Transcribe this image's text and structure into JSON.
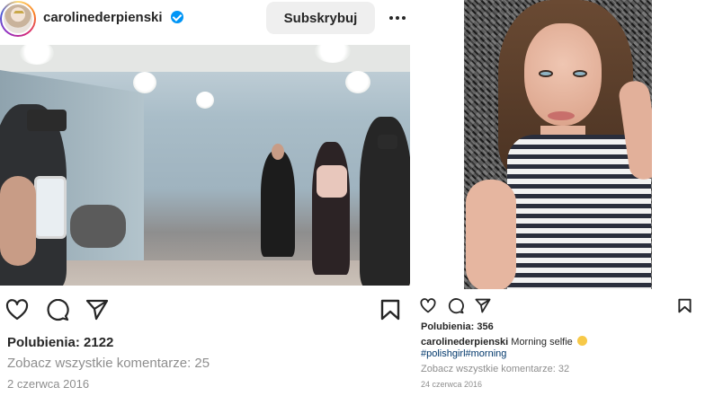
{
  "left_post": {
    "username": "carolinederpienski",
    "verified_icon": "verified-badge-icon",
    "follow_label": "Subskrybuj",
    "more_icon": "more-options-icon",
    "likes": "Polubienia: 2122",
    "comments_link": "Zobacz wszystkie komentarze: 25",
    "date": "2 czerwca 2016",
    "actions": [
      "heart-icon",
      "comment-icon",
      "share-icon",
      "bookmark-icon"
    ]
  },
  "right_post": {
    "likes": "Polubienia: 356",
    "caption_user": "carolinederpienski",
    "caption_text": " Morning selfie ",
    "emoji": "smiling-face-emoji",
    "hashtags": [
      "#polishgirl",
      "#morning"
    ],
    "comments_link": "Zobacz wszystkie komentarze: 32",
    "date": "24 czerwca 2016",
    "actions": [
      "heart-icon",
      "comment-icon",
      "share-icon",
      "bookmark-icon"
    ]
  },
  "colors": {
    "text": "#262626",
    "secondary": "#8e8e8e",
    "link": "#00376b",
    "verified": "#0095f6",
    "button_bg": "#efefef"
  }
}
